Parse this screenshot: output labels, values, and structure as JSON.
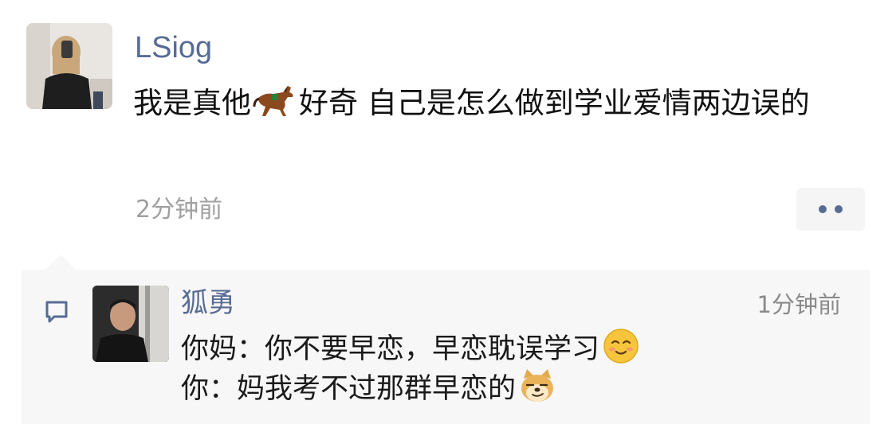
{
  "post": {
    "author": "LSiog",
    "text_part1": "我是真他",
    "text_part2": "好奇 自己是怎么做到学业爱情两边误的",
    "time": "2分钟前",
    "inline_icon": "horse-emoji"
  },
  "comment": {
    "author": "狐勇",
    "time": "1分钟前",
    "line1": "你妈：你不要早恋，早恋耽误学习",
    "line1_icon": "smiling-face-emoji",
    "line2": "你：妈我考不过那群早恋的",
    "line2_icon": "doge-emoji"
  },
  "colors": {
    "link_blue": "#576b95",
    "meta_gray": "#a0a0a0",
    "comment_bg": "#f7f7f7"
  }
}
